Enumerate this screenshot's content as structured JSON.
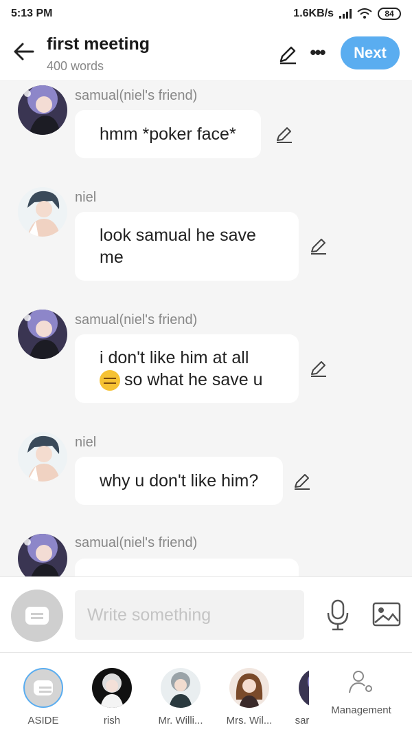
{
  "status_bar": {
    "time": "5:13 PM",
    "network": "1.6KB/s",
    "battery": "84"
  },
  "header": {
    "title": "first meeting",
    "subtitle": "400 words",
    "next_label": "Next"
  },
  "messages": [
    {
      "sender": "samual(niel's friend)",
      "text": "hmm *poker face*",
      "avatar": "samual-avatar"
    },
    {
      "sender": "niel",
      "text_line1": "look samual he save",
      "text_line2": "me",
      "avatar": "niel-avatar"
    },
    {
      "sender": "samual(niel's friend)",
      "text_line1": "i don't like him at all",
      "text_line2": "so what he save u",
      "emoji": "expressionless-face-emoji",
      "avatar": "samual-avatar"
    },
    {
      "sender": "niel",
      "text": "why u don't like him?",
      "avatar": "niel-avatar"
    },
    {
      "sender": "samual(niel's friend)",
      "avatar": "samual-avatar"
    }
  ],
  "composer": {
    "placeholder": "Write something"
  },
  "characters": [
    {
      "label": "ASIDE"
    },
    {
      "label": "rish"
    },
    {
      "label": "Mr. Willi..."
    },
    {
      "label": "Mrs. Wil..."
    },
    {
      "label": "sar"
    }
  ],
  "management_label": "Management",
  "colors": {
    "accent": "#5aadf0",
    "background": "#f5f5f5",
    "bubble": "#ffffff"
  }
}
